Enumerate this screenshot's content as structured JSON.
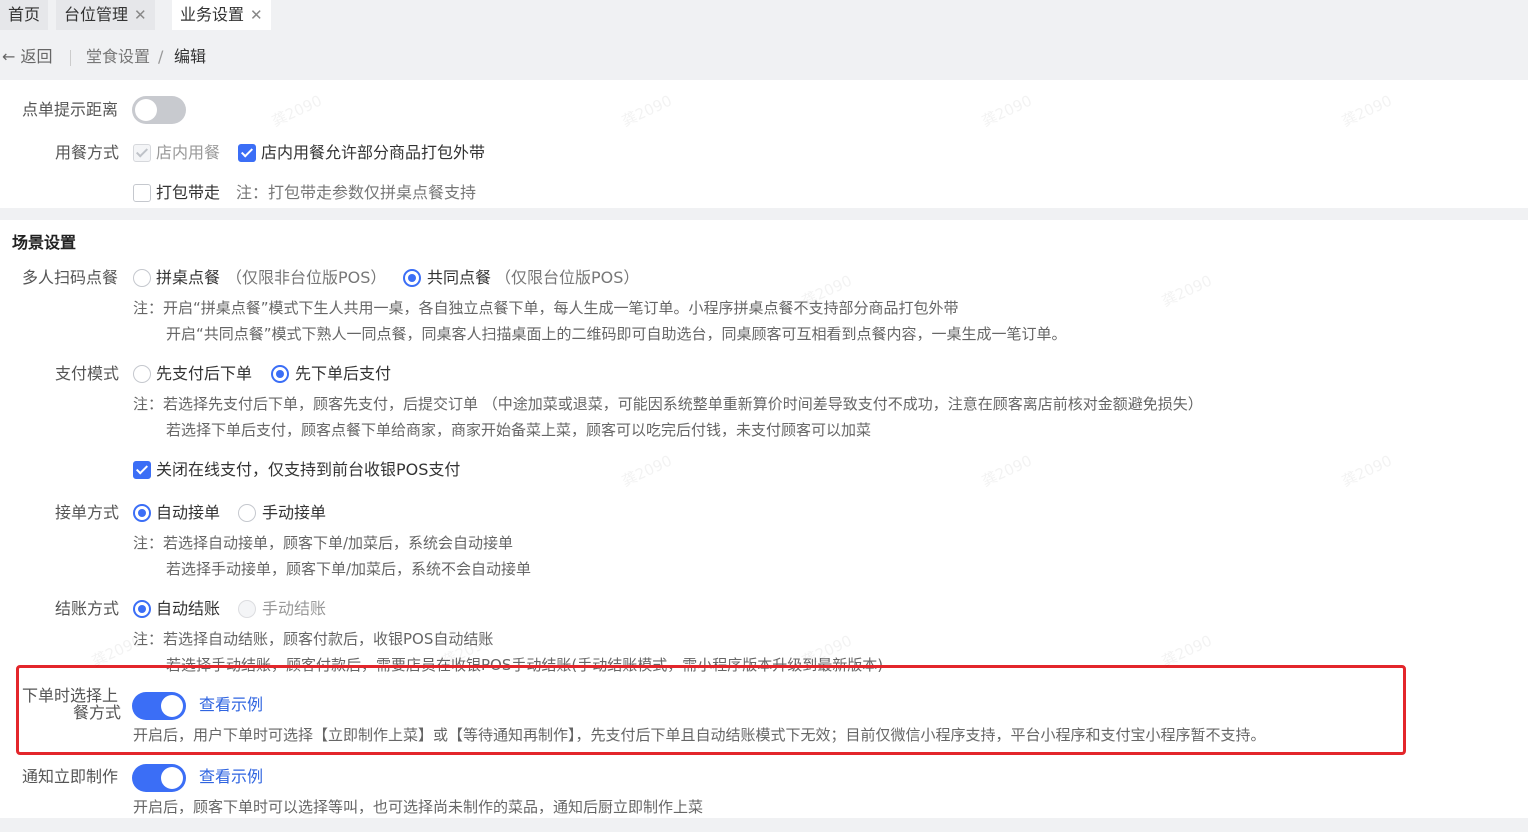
{
  "tabs": [
    {
      "label": "首页",
      "closable": false,
      "active": false
    },
    {
      "label": "台位管理",
      "closable": true,
      "active": false
    },
    {
      "label": "业务设置",
      "closable": true,
      "active": true
    }
  ],
  "tab_close_glyph": "✕",
  "breadcrumb": {
    "back_label": "← 返回",
    "parent": "堂食设置",
    "separator": "/",
    "current": "编辑"
  },
  "order_prompt": {
    "label": "点单提示距离",
    "enabled": false
  },
  "dining_mode": {
    "label": "用餐方式",
    "dine_in": {
      "label": "店内用餐",
      "checked": true,
      "disabled": true
    },
    "allow_takeout": {
      "label": "店内用餐允许部分商品打包外带",
      "checked": true
    },
    "takeaway": {
      "label": "打包带走",
      "checked": false
    },
    "takeaway_note": "注：打包带走参数仅拼桌点餐支持"
  },
  "scene": {
    "section_title": "场景设置",
    "multi_scan": {
      "label": "多人扫码点餐",
      "opt1": {
        "label": "拼桌点餐",
        "hint": "（仅限非台位版POS）",
        "selected": false
      },
      "opt2": {
        "label": "共同点餐",
        "hint": "（仅限台位版POS）",
        "selected": true
      },
      "note1": "注：开启“拼桌点餐”模式下生人共用一桌，各自独立点餐下单，每人生成一笔订单。小程序拼桌点餐不支持部分商品打包外带",
      "note2": "开启“共同点餐”模式下熟人一同点餐，同桌客人扫描桌面上的二维码即可自助选台，同桌顾客可互相看到点餐内容，一桌生成一笔订单。"
    },
    "payment": {
      "label": "支付模式",
      "opt1": {
        "label": "先支付后下单",
        "selected": false
      },
      "opt2": {
        "label": "先下单后支付",
        "selected": true
      },
      "note1": "注：若选择先支付后下单，顾客先支付，后提交订单 （中途加菜或退菜，可能因系统整单重新算价时间差导致支付不成功，注意在顾客离店前核对金额避免损失）",
      "note2": "若选择下单后支付，顾客点餐下单给商家，商家开始备菜上菜，顾客可以吃完后付钱，未支付顾客可以加菜",
      "close_online": {
        "label": "关闭在线支付，仅支持到前台收银POS支付",
        "checked": true
      }
    },
    "accept": {
      "label": "接单方式",
      "opt1": {
        "label": "自动接单",
        "selected": true
      },
      "opt2": {
        "label": "手动接单",
        "selected": false
      },
      "note1": "注：若选择自动接单，顾客下单/加菜后，系统会自动接单",
      "note2": "若选择手动接单，顾客下单/加菜后，系统不会自动接单"
    },
    "checkout": {
      "label": "结账方式",
      "opt1": {
        "label": "自动结账",
        "selected": true
      },
      "opt2": {
        "label": "手动结账",
        "selected": false,
        "disabled": true
      },
      "note1": "注：若选择自动结账，顾客付款后，收银POS自动结账",
      "note2": "若选择手动结账，顾客付款后，需要店员在收银POS手动结账(手动结账模式，需小程序版本升级到最新版本)"
    },
    "serve_mode": {
      "label_line1": "下单时选择上",
      "label_line2": "餐方式",
      "enabled": true,
      "link": "查看示例",
      "note": "开启后，用户下单时可选择【立即制作上菜】或【等待通知再制作】，先支付后下单且自动结账模式下无效；目前仅微信小程序支持，平台小程序和支付宝小程序暂不支持。"
    },
    "notify": {
      "label": "通知立即制作",
      "enabled": true,
      "link": "查看示例",
      "note": "开启后，顾客下单时可以选择等叫，也可选择尚未制作的菜品，通知后厨立即制作上菜"
    }
  },
  "watermark_text": "龚2090",
  "colors": {
    "accent": "#3b6ef6",
    "link": "#2f64e0",
    "highlight_border": "#e3262b",
    "switch_off": "#c8cacf"
  }
}
